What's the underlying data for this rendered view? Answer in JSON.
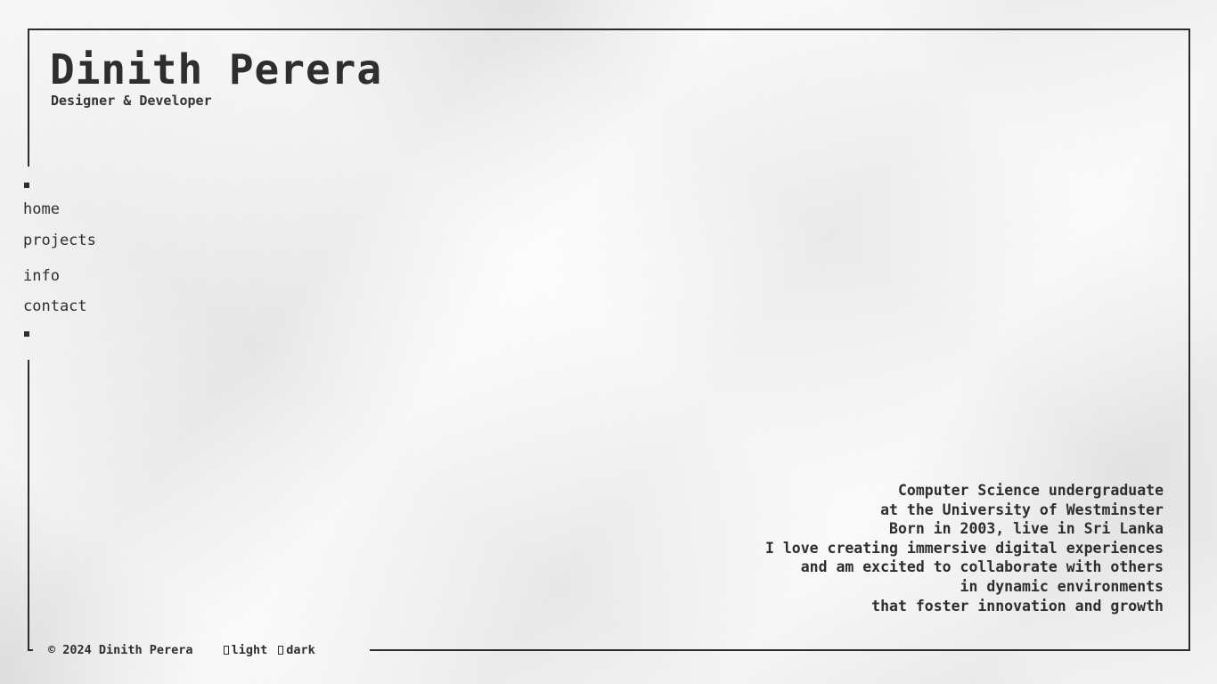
{
  "header": {
    "title": "Dinith Perera",
    "subtitle": "Designer & Developer"
  },
  "nav": {
    "items": [
      {
        "label": "home"
      },
      {
        "label": "projects"
      },
      {
        "label": "info"
      },
      {
        "label": "contact"
      }
    ]
  },
  "about": {
    "lines": [
      "Computer Science undergraduate",
      "at the University of Westminster",
      "Born in 2003, live in Sri Lanka",
      "I love creating immersive digital experiences",
      "and am excited to collaborate with others",
      "in dynamic environments",
      "that foster innovation and growth"
    ]
  },
  "footer": {
    "copyright": "© 2024 Dinith Perera",
    "theme_light_label": "light",
    "theme_dark_label": "dark",
    "theme_light_icon": "box-icon",
    "theme_dark_icon": "box-icon"
  },
  "colors": {
    "text": "#2e2e2e",
    "frame": "#2b2b2b",
    "background": "#f1f1f1"
  }
}
